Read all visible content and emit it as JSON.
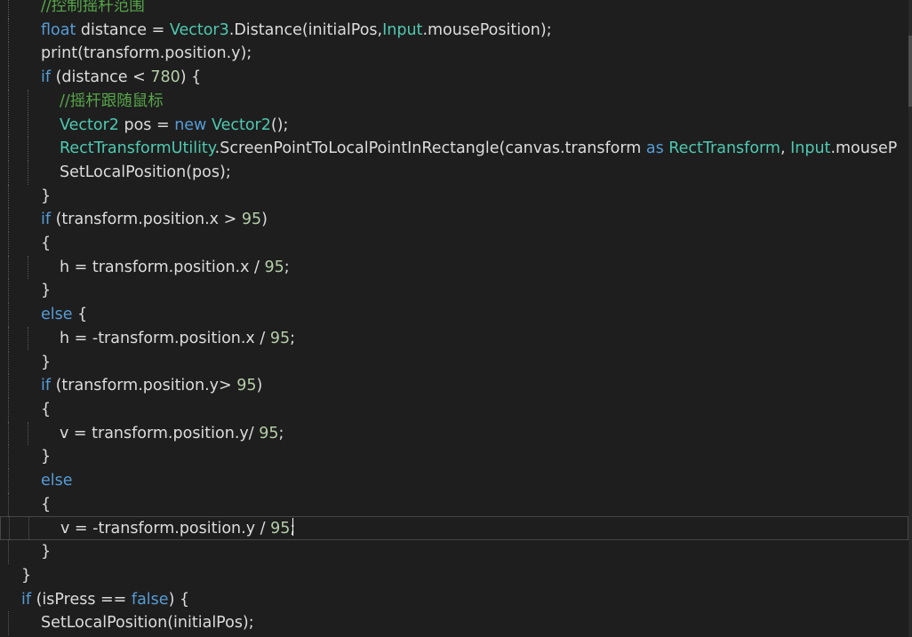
{
  "editor": {
    "lines": [
      {
        "indent": 2,
        "segments": [
          {
            "cls": "cm",
            "text": "//控制摇杆范围"
          }
        ]
      },
      {
        "indent": 2,
        "segments": [
          {
            "cls": "kw",
            "text": "float"
          },
          {
            "cls": "pl",
            "text": " distance = "
          },
          {
            "cls": "ty",
            "text": "Vector3"
          },
          {
            "cls": "pl",
            "text": ".Distance(initialPos,"
          },
          {
            "cls": "ty",
            "text": "Input"
          },
          {
            "cls": "pl",
            "text": ".mousePosition);"
          }
        ]
      },
      {
        "indent": 2,
        "segments": [
          {
            "cls": "pl",
            "text": "print(transform.position.y);"
          }
        ]
      },
      {
        "indent": 2,
        "segments": [
          {
            "cls": "kw",
            "text": "if"
          },
          {
            "cls": "pl",
            "text": " (distance < "
          },
          {
            "cls": "nu",
            "text": "780"
          },
          {
            "cls": "pl",
            "text": ") {"
          }
        ]
      },
      {
        "indent": 3,
        "segments": [
          {
            "cls": "cm",
            "text": "//摇杆跟随鼠标"
          }
        ]
      },
      {
        "indent": 3,
        "segments": [
          {
            "cls": "ty",
            "text": "Vector2"
          },
          {
            "cls": "pl",
            "text": " pos = "
          },
          {
            "cls": "kw",
            "text": "new"
          },
          {
            "cls": "pl",
            "text": " "
          },
          {
            "cls": "ty",
            "text": "Vector2"
          },
          {
            "cls": "pl",
            "text": "();"
          }
        ]
      },
      {
        "indent": 3,
        "segments": [
          {
            "cls": "ty",
            "text": "RectTransformUtility"
          },
          {
            "cls": "pl",
            "text": ".ScreenPointToLocalPointInRectangle(canvas.transform "
          },
          {
            "cls": "kw",
            "text": "as"
          },
          {
            "cls": "pl",
            "text": " "
          },
          {
            "cls": "ty",
            "text": "RectTransform"
          },
          {
            "cls": "pl",
            "text": ", "
          },
          {
            "cls": "ty",
            "text": "Input"
          },
          {
            "cls": "pl",
            "text": ".mouseP"
          }
        ]
      },
      {
        "indent": 3,
        "segments": [
          {
            "cls": "pl",
            "text": "SetLocalPosition(pos);"
          }
        ]
      },
      {
        "indent": 2,
        "segments": [
          {
            "cls": "pl",
            "text": "}"
          }
        ]
      },
      {
        "indent": 2,
        "segments": [
          {
            "cls": "kw",
            "text": "if"
          },
          {
            "cls": "pl",
            "text": " (transform.position.x > "
          },
          {
            "cls": "nu",
            "text": "95"
          },
          {
            "cls": "pl",
            "text": ")"
          }
        ]
      },
      {
        "indent": 2,
        "segments": [
          {
            "cls": "pl",
            "text": "{"
          }
        ]
      },
      {
        "indent": 3,
        "segments": [
          {
            "cls": "pl",
            "text": "h = transform.position.x / "
          },
          {
            "cls": "nu",
            "text": "95"
          },
          {
            "cls": "pl",
            "text": ";"
          }
        ]
      },
      {
        "indent": 2,
        "segments": [
          {
            "cls": "pl",
            "text": "}"
          }
        ]
      },
      {
        "indent": 2,
        "segments": [
          {
            "cls": "kw",
            "text": "else"
          },
          {
            "cls": "pl",
            "text": " {"
          }
        ]
      },
      {
        "indent": 3,
        "segments": [
          {
            "cls": "pl",
            "text": "h = -transform.position.x / "
          },
          {
            "cls": "nu",
            "text": "95"
          },
          {
            "cls": "pl",
            "text": ";"
          }
        ]
      },
      {
        "indent": 2,
        "segments": [
          {
            "cls": "pl",
            "text": "}"
          }
        ]
      },
      {
        "indent": 2,
        "segments": [
          {
            "cls": "kw",
            "text": "if"
          },
          {
            "cls": "pl",
            "text": " (transform.position.y> "
          },
          {
            "cls": "nu",
            "text": "95"
          },
          {
            "cls": "pl",
            "text": ")"
          }
        ]
      },
      {
        "indent": 2,
        "segments": [
          {
            "cls": "pl",
            "text": "{"
          }
        ]
      },
      {
        "indent": 3,
        "segments": [
          {
            "cls": "pl",
            "text": "v = transform.position.y/ "
          },
          {
            "cls": "nu",
            "text": "95"
          },
          {
            "cls": "pl",
            "text": ";"
          }
        ]
      },
      {
        "indent": 2,
        "segments": [
          {
            "cls": "pl",
            "text": "}"
          }
        ]
      },
      {
        "indent": 2,
        "segments": [
          {
            "cls": "kw",
            "text": "else"
          }
        ]
      },
      {
        "indent": 2,
        "segments": [
          {
            "cls": "pl",
            "text": "{"
          }
        ]
      },
      {
        "indent": 3,
        "current": true,
        "segments": [
          {
            "cls": "pl",
            "text": "v = -transform.position.y / "
          },
          {
            "cls": "nu",
            "text": "95"
          },
          {
            "cls": "pl",
            "text": ";"
          }
        ]
      },
      {
        "indent": 2,
        "segments": [
          {
            "cls": "pl",
            "text": "}"
          }
        ]
      },
      {
        "indent": 1,
        "segments": [
          {
            "cls": "pl",
            "text": "}"
          }
        ]
      },
      {
        "indent": 1,
        "segments": [
          {
            "cls": "kw",
            "text": "if"
          },
          {
            "cls": "pl",
            "text": " (isPress == "
          },
          {
            "cls": "kw",
            "text": "false"
          },
          {
            "cls": "pl",
            "text": ") {"
          }
        ]
      },
      {
        "indent": 2,
        "segments": [
          {
            "cls": "pl",
            "text": "SetLocalPosition(initialPos);"
          }
        ]
      }
    ]
  },
  "colors": {
    "background": "#1e1e1e",
    "keyword": "#569cd6",
    "type": "#4ec9b0",
    "comment": "#57a64a",
    "number": "#b5cea8",
    "plain": "#dcdcdc"
  }
}
